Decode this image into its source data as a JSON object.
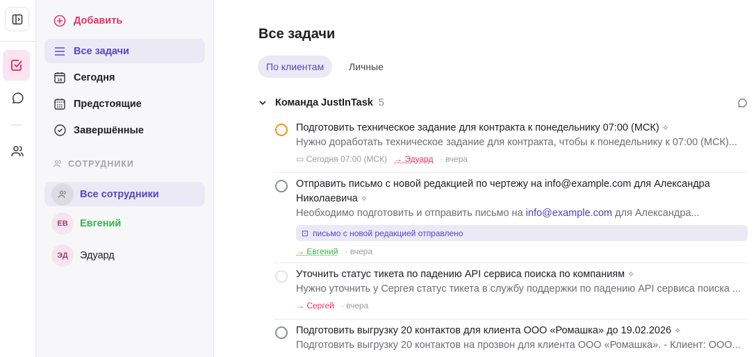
{
  "sidebar": {
    "add": "Добавить",
    "items": [
      "Все задачи",
      "Сегодня",
      "Предстоящие",
      "Завершённые"
    ],
    "section": "СОТРУДНИКИ",
    "all_staff": "Все сотрудники",
    "staff": [
      {
        "initials": "ЕВ",
        "name": "Евгений"
      },
      {
        "initials": "ЭД",
        "name": "Эдуард"
      }
    ]
  },
  "main": {
    "title": "Все задачи",
    "tabs": [
      "По клиентам",
      "Личные"
    ],
    "group": {
      "name": "Команда JustInTask",
      "count": "5"
    },
    "tasks": [
      {
        "title": "Подготовить техническое задание для контракта к понедельнику 07:00 (МСК)",
        "desc": "Нужно доработать техническое задание для контракта, чтобы к понедельнику к 07:00 (МСК)...",
        "due": "Сегодня 07:00 (МСК)",
        "assignee": "→ Эдуард",
        "time": "· вчера"
      },
      {
        "title": "Отправить письмо с новой редакцией по чертежу на info@example.com для Александра Николаевича",
        "desc_pre": "Необходимо подготовить и отправить письмо на ",
        "desc_link": "info@example.com",
        "desc_post": " для Александра...",
        "chip": "письмо с новой редакцией отправлено",
        "assignee": "→ Евгений",
        "time": "· вчера"
      },
      {
        "title": "Уточнить статус тикета по падению API сервиса поиска по компаниям",
        "desc": "Нужно уточнить у Сергея статус тикета в службу поддержки по падению API сервиса поиска ...",
        "assignee": "→ Сергей",
        "time": "· вчера"
      },
      {
        "title": "Подготовить выгрузку 20 контактов для клиента ООО «Ромашка» до 19.02.2026",
        "desc": "Подготовить выгрузку 20 контактов на прозвон для клиента ООО «Ромашка». - Клиент: ООО..."
      }
    ]
  },
  "colors": {
    "accent": "#5a45c2",
    "red": "#e8325e",
    "green": "#3bb24a",
    "orange": "#f0960e"
  }
}
